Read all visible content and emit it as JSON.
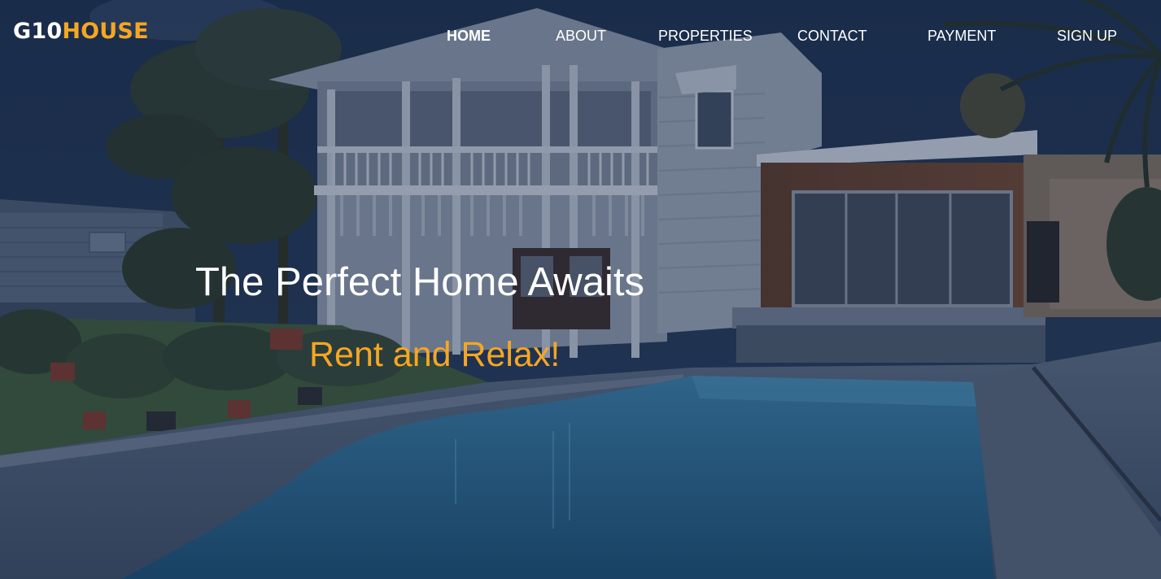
{
  "brand": {
    "logo_part1": "G10",
    "logo_part2": "HOUSE"
  },
  "nav": {
    "items": [
      {
        "label": "HOME",
        "active": true
      },
      {
        "label": "ABOUT",
        "active": false
      },
      {
        "label": "PROPERTIES",
        "active": false
      },
      {
        "label": "CONTACT",
        "active": false
      },
      {
        "label": "PAYMENT",
        "active": false
      },
      {
        "label": "SIGN UP",
        "active": false
      }
    ]
  },
  "hero": {
    "headline": "The Perfect Home Awaits",
    "subheadline": "Rent and Relax!"
  },
  "colors": {
    "accent": "#f5a623",
    "text": "#ffffff",
    "overlay": "#12213c"
  }
}
